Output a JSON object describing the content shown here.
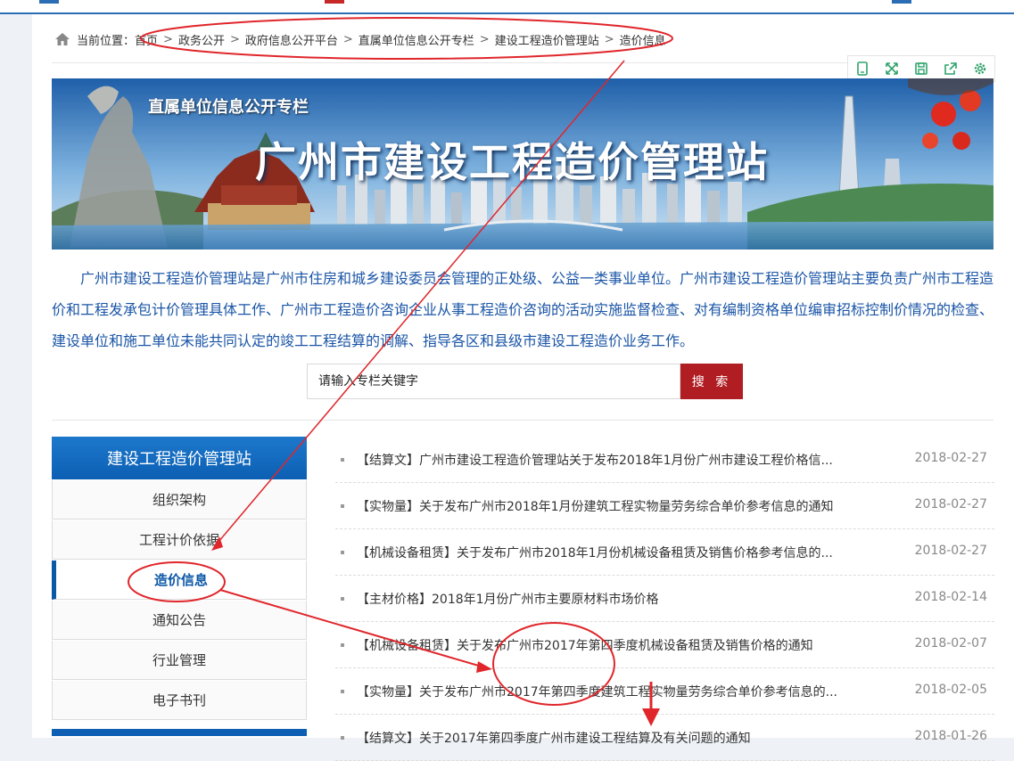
{
  "breadcrumb": {
    "label": "当前位置：",
    "items": [
      "首页",
      "政务公开",
      "政府信息公开平台",
      "直属单位信息公开专栏",
      "建设工程造价管理站",
      "造价信息"
    ]
  },
  "tools": [
    "mobile-icon",
    "fullscreen-icon",
    "save-icon",
    "share-icon",
    "settings-icon"
  ],
  "banner": {
    "subtitle": "直属单位信息公开专栏",
    "title": "广州市建设工程造价管理站"
  },
  "intro": "广州市建设工程造价管理站是广州市住房和城乡建设委员会管理的正处级、公益一类事业单位。广州市建设工程造价管理站主要负责广州市工程造价和工程发承包计价管理具体工作、广州市工程造价咨询企业从事工程造价咨询的活动实施监督检查、对有编制资格单位编审招标控制价情况的检查、建设单位和施工单位未能共同认定的竣工工程结算的调解、指导各区和县级市建设工程造价业务工作。",
  "search": {
    "placeholder": "请输入专栏关键字",
    "button": "搜 索"
  },
  "sidebar": {
    "title": "建设工程造价管理站",
    "items": [
      {
        "label": "组织架构",
        "active": false
      },
      {
        "label": "工程计价依据",
        "active": false
      },
      {
        "label": "造价信息",
        "active": true
      },
      {
        "label": "通知公告",
        "active": false
      },
      {
        "label": "行业管理",
        "active": false
      },
      {
        "label": "电子书刊",
        "active": false
      }
    ]
  },
  "news": [
    {
      "title": "【结算文】广州市建设工程造价管理站关于发布2018年1月份广州市建设工程价格信...",
      "date": "2018-02-27"
    },
    {
      "title": "【实物量】关于发布广州市2018年1月份建筑工程实物量劳务综合单价参考信息的通知",
      "date": "2018-02-27"
    },
    {
      "title": "【机械设备租赁】关于发布广州市2018年1月份机械设备租赁及销售价格参考信息的...",
      "date": "2018-02-27"
    },
    {
      "title": "【主材价格】2018年1月份广州市主要原材料市场价格",
      "date": "2018-02-14"
    },
    {
      "title": "【机械设备租赁】关于发布广州市2017年第四季度机械设备租赁及销售价格的通知",
      "date": "2018-02-07"
    },
    {
      "title": "【实物量】关于发布广州市2017年第四季度建筑工程实物量劳务综合单价参考信息的...",
      "date": "2018-02-05"
    },
    {
      "title": "【结算文】关于2017年第四季度广州市建设工程结算及有关问题的通知",
      "date": "2018-01-26"
    }
  ],
  "colors": {
    "accent": "#0c5fb3",
    "search_button": "#b01e23",
    "annotation": "#e0262b",
    "intro_text": "#1a55a6"
  }
}
